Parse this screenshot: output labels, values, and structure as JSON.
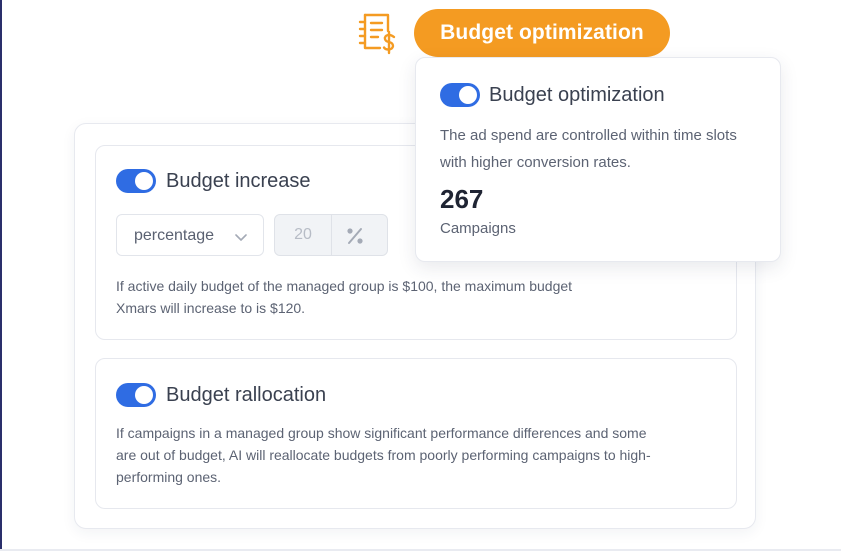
{
  "header": {
    "badge_label": "Budget optimization",
    "icon": "invoice-dollar-icon",
    "accent_color": "#f49b22"
  },
  "popup": {
    "title": "Budget optimization",
    "toggle_on": true,
    "description": "The ad spend are controlled within time slots with higher conversion rates.",
    "count": "267",
    "count_label": "Campaigns"
  },
  "budget_increase": {
    "title": "Budget increase",
    "toggle_on": true,
    "mode_select": "percentage",
    "amount_value": "20",
    "unit_icon": "percent-icon",
    "description": "If active daily budget of the managed group is $100, the maximum budget Xmars will increase to is $120."
  },
  "budget_reallocation": {
    "title": "Budget rallocation",
    "toggle_on": true,
    "description": "If campaigns in a managed group show significant performance differences and some are out of budget, AI will reallocate budgets from poorly performing campaigns to high-performing ones."
  },
  "colors": {
    "toggle_blue": "#2f6ce3",
    "text_primary": "#3a4150",
    "text_secondary": "#5c6373"
  }
}
